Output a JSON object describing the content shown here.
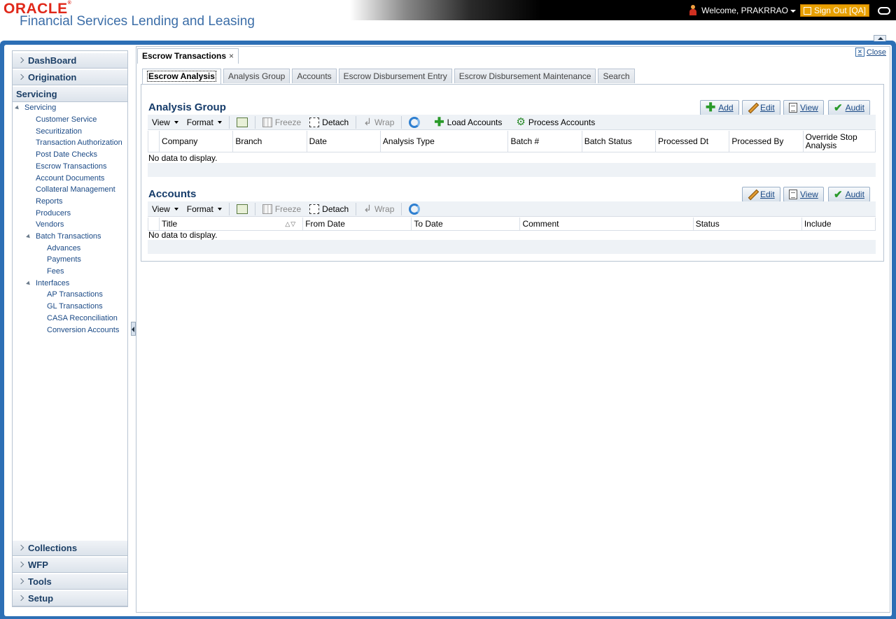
{
  "header": {
    "logo": "ORACLE",
    "product": "Financial Services Lending and Leasing",
    "welcome": "Welcome, PRAKRRAO",
    "signout": "Sign Out [QA]"
  },
  "sidebar": {
    "top_sections": [
      "DashBoard",
      "Origination",
      "Servicing"
    ],
    "bottom_sections": [
      "Collections",
      "WFP",
      "Tools",
      "Setup"
    ],
    "tree_root": "Servicing",
    "items": [
      "Customer Service",
      "Securitization",
      "Transaction Authorization",
      "Post Date Checks",
      "Escrow Transactions",
      "Account Documents",
      "Collateral Management",
      "Reports",
      "Producers",
      "Vendors"
    ],
    "batch": {
      "label": "Batch Transactions",
      "children": [
        "Advances",
        "Payments",
        "Fees"
      ]
    },
    "interfaces": {
      "label": "Interfaces",
      "children": [
        "AP Transactions",
        "GL Transactions",
        "CASA Reconciliation",
        "Conversion Accounts"
      ]
    }
  },
  "page": {
    "tab_title": "Escrow Transactions",
    "close": "Close",
    "subtabs": [
      "Escrow Analysis",
      "Analysis Group",
      "Accounts",
      "Escrow Disbursement Entry",
      "Escrow Disbursement Maintenance",
      "Search"
    ]
  },
  "analysis_group": {
    "title": "Analysis Group",
    "buttons": {
      "add": "Add",
      "edit": "Edit",
      "view": "View",
      "audit": "Audit"
    },
    "toolbar": {
      "view": "View",
      "format": "Format",
      "freeze": "Freeze",
      "detach": "Detach",
      "wrap": "Wrap",
      "load_accounts": "Load Accounts",
      "process_accounts": "Process Accounts"
    },
    "columns": [
      "Company",
      "Branch",
      "Date",
      "Analysis Type",
      "Batch #",
      "Batch Status",
      "Processed Dt",
      "Processed By",
      "Override Stop Analysis"
    ],
    "empty": "No data to display."
  },
  "accounts": {
    "title": "Accounts",
    "buttons": {
      "edit": "Edit",
      "view": "View",
      "audit": "Audit"
    },
    "toolbar": {
      "view": "View",
      "format": "Format",
      "freeze": "Freeze",
      "detach": "Detach",
      "wrap": "Wrap"
    },
    "columns": [
      "Title",
      "From Date",
      "To Date",
      "Comment",
      "Status",
      "Include"
    ],
    "empty": "No data to display."
  }
}
